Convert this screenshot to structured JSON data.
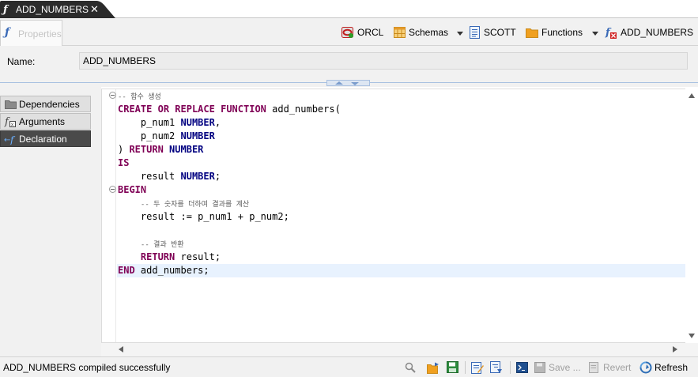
{
  "editor_tab": {
    "title": "ADD_NUMBERS",
    "icon": "function-icon",
    "close_glyph": "✕"
  },
  "properties_tab": {
    "label": "Properties",
    "icon": "function-icon"
  },
  "toolbar": {
    "connection": {
      "label": "ORCL",
      "icon": "oracle-connection-icon"
    },
    "schemas": {
      "label": "Schemas",
      "icon": "schemas-table-icon"
    },
    "schema": {
      "label": "SCOTT",
      "icon": "schema-document-icon"
    },
    "functions": {
      "label": "Functions",
      "icon": "folder-icon"
    },
    "object": {
      "label": "ADD_NUMBERS",
      "icon": "function-error-icon"
    }
  },
  "name_row": {
    "label": "Name:",
    "value": "ADD_NUMBERS"
  },
  "side_tabs": [
    {
      "label": "Dependencies",
      "icon": "folder-icon",
      "active": false
    },
    {
      "label": "Arguments",
      "icon": "function-arguments-icon",
      "active": false
    },
    {
      "label": "Declaration",
      "icon": "declaration-icon",
      "active": true
    }
  ],
  "code_lines": [
    "-- 함수 생성",
    "CREATE OR REPLACE FUNCTION add_numbers(",
    "    p_num1 NUMBER,",
    "    p_num2 NUMBER",
    ") RETURN NUMBER",
    "IS",
    "    result NUMBER;",
    "BEGIN",
    "    -- 두 숫자를 더하여 결과를 계산",
    "    result := p_num1 + p_num2;",
    "",
    "    -- 결과 반환",
    "    RETURN result;",
    "END add_numbers;"
  ],
  "status": {
    "message": "ADD_NUMBERS compiled successfully",
    "buttons": {
      "save": "Save ...",
      "revert": "Revert",
      "refresh": "Refresh"
    }
  },
  "colors": {
    "accent": "#2f6fb7",
    "keyword": "#7f0055",
    "type": "#000080",
    "active_tab": "#4a4a4a",
    "current_line": "#e8f2fe"
  }
}
